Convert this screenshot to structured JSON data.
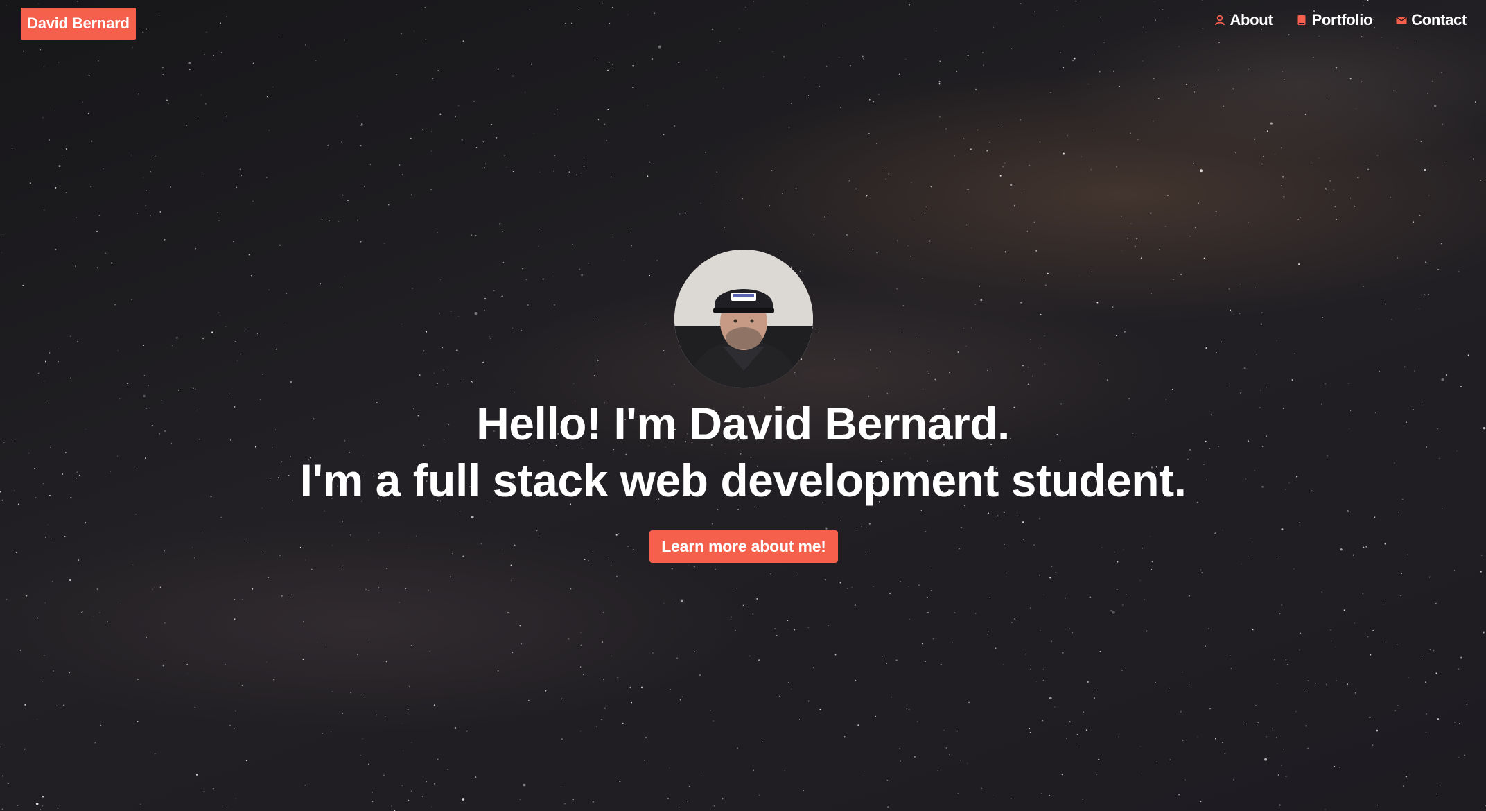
{
  "nav": {
    "brand": "David Bernard",
    "items": [
      {
        "label": "About",
        "icon": "user-icon"
      },
      {
        "label": "Portfolio",
        "icon": "book-icon"
      },
      {
        "label": "Contact",
        "icon": "envelope-icon"
      }
    ]
  },
  "hero": {
    "avatar_alt": "profile-photo",
    "line1": "Hello! I'm David Bernard.",
    "line2": "I'm a full stack web development student.",
    "cta_label": "Learn more about me!"
  },
  "colors": {
    "accent": "#f5604d",
    "text": "#ffffff",
    "background": "#1d1b1f"
  }
}
